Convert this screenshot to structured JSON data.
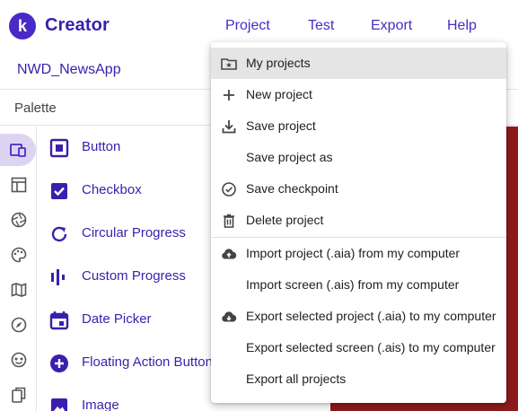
{
  "app": {
    "brand": "Creator",
    "logo_letter": "k"
  },
  "menu": {
    "project": "Project",
    "test": "Test",
    "export": "Export",
    "help": "Help"
  },
  "project": {
    "name": "NWD_NewsApp"
  },
  "palette": {
    "title": "Palette",
    "items": [
      {
        "label": "Button",
        "icon": "button-icon"
      },
      {
        "label": "Checkbox",
        "icon": "checkbox-icon"
      },
      {
        "label": "Circular Progress",
        "icon": "circular-progress-icon"
      },
      {
        "label": "Custom Progress",
        "icon": "custom-progress-icon"
      },
      {
        "label": "Date Picker",
        "icon": "date-picker-icon"
      },
      {
        "label": "Floating Action Button",
        "icon": "floating-action-button-icon"
      },
      {
        "label": "Image",
        "icon": "image-icon"
      }
    ]
  },
  "rail": [
    "user-interface-icon",
    "layout-icon",
    "media-icon",
    "drawing-icon",
    "maps-icon",
    "sensors-icon",
    "social-icon",
    "storage-icon"
  ],
  "project_menu": {
    "items": [
      {
        "label": "My projects",
        "icon": "folder-star-icon",
        "highlighted": true
      },
      {
        "label": "New project",
        "icon": "plus-icon"
      },
      {
        "label": "Save project",
        "icon": "download-icon"
      },
      {
        "label": "Save project as",
        "icon": ""
      },
      {
        "label": "Save checkpoint",
        "icon": "check-circle-icon"
      },
      {
        "label": "Delete project",
        "icon": "trash-icon"
      },
      {
        "label": "Import project (.aia) from my computer",
        "icon": "cloud-upload-icon"
      },
      {
        "label": "Import screen (.ais) from my computer",
        "icon": ""
      },
      {
        "label": "Export selected project (.aia) to my computer",
        "icon": "cloud-download-icon"
      },
      {
        "label": "Export selected screen (.ais) to my computer",
        "icon": ""
      },
      {
        "label": "Export all projects",
        "icon": ""
      }
    ]
  },
  "colors": {
    "accent": "#4a2ac6",
    "brand_text": "#3a1fae",
    "rail_active": "#ddd4f3",
    "viewer": "#8e1b1b"
  }
}
